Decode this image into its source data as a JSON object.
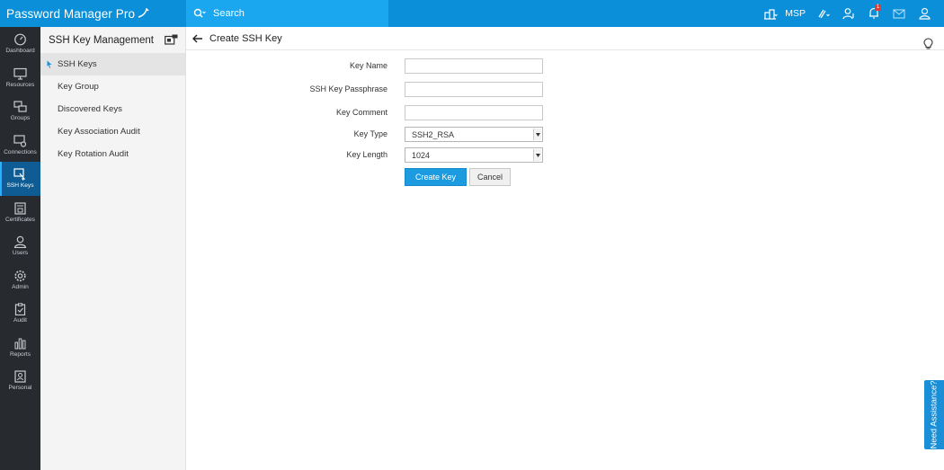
{
  "app": {
    "brand": "Password Manager Pro"
  },
  "topbar": {
    "search_placeholder": "Search",
    "msp_label": "MSP",
    "notification_count": "1",
    "icons": [
      "organization-icon",
      "link-icon",
      "user-alert-icon",
      "bell-icon",
      "mail-icon",
      "user-profile-icon"
    ]
  },
  "leftnav": {
    "items": [
      {
        "label": "Dashboard",
        "icon": "dashboard-icon"
      },
      {
        "label": "Resources",
        "icon": "monitor-icon"
      },
      {
        "label": "Groups",
        "icon": "groups-icon"
      },
      {
        "label": "Connections",
        "icon": "connections-icon"
      },
      {
        "label": "SSH Keys",
        "icon": "ssh-key-icon",
        "active": true
      },
      {
        "label": "Certificates",
        "icon": "certificate-icon"
      },
      {
        "label": "Users",
        "icon": "user-icon"
      },
      {
        "label": "Admin",
        "icon": "gear-icon"
      },
      {
        "label": "Audit",
        "icon": "clipboard-icon"
      },
      {
        "label": "Reports",
        "icon": "bar-chart-icon"
      },
      {
        "label": "Personal",
        "icon": "personal-icon"
      }
    ]
  },
  "subsidebar": {
    "title": "SSH Key Management",
    "items": [
      {
        "label": "SSH Keys",
        "active": true
      },
      {
        "label": "Key Group"
      },
      {
        "label": "Discovered Keys"
      },
      {
        "label": "Key Association Audit"
      },
      {
        "label": "Key Rotation Audit"
      }
    ]
  },
  "main": {
    "title": "Create SSH Key",
    "form": {
      "key_name_label": "Key Name",
      "key_name_value": "",
      "passphrase_label": "SSH Key Passphrase",
      "passphrase_value": "",
      "comment_label": "Key Comment",
      "comment_value": "",
      "key_type_label": "Key Type",
      "key_type_value": "SSH2_RSA",
      "key_length_label": "Key Length",
      "key_length_value": "1024"
    },
    "create_button": "Create Key",
    "cancel_button": "Cancel"
  },
  "assist": {
    "label": "Need Assistance?"
  },
  "colors": {
    "topbar": "#0a8fd8",
    "search": "#1aa7ef",
    "nav_bg": "#272b30",
    "nav_active": "#0e5c93",
    "primary_button": "#1d9be0"
  }
}
